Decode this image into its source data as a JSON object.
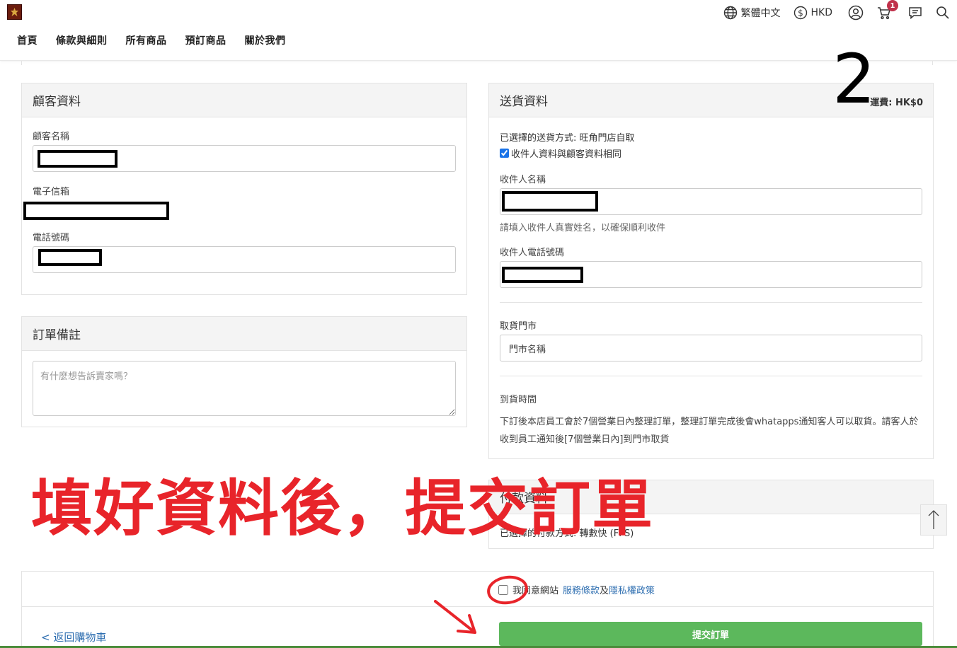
{
  "header": {
    "nav": [
      "首頁",
      "條款與細則",
      "所有商品",
      "預訂商品",
      "關於我們"
    ],
    "language": "繁體中文",
    "currency": "HKD",
    "cart_count": "1"
  },
  "customer": {
    "title": "顧客資料",
    "name_label": "顧客名稱",
    "email_label": "電子信箱",
    "phone_label": "電話號碼"
  },
  "note": {
    "title": "訂單備註",
    "placeholder": "有什麼想告訴賣家嗎？"
  },
  "delivery": {
    "title": "送貨資料",
    "fee": "運費: HK$0",
    "method": "已選擇的送貨方式: 旺角門店自取",
    "same_as_customer": "收件人資料與顧客資料相同",
    "recipient_name_label": "收件人名稱",
    "recipient_hint": "請填入收件人真實姓名，以確保順利收件",
    "recipient_phone_label": "收件人電話號碼",
    "pickup_store_label": "取貨門市",
    "pickup_store_value": "門市名稱",
    "arrival_label": "到貨時間",
    "arrival_text": "下訂後本店員工會於7個營業日內整理訂單，整理訂單完成後會whatapps通知客人可以取貨。請客人於收到員工通知後[7個營業日內]到門市取貨"
  },
  "payment": {
    "title": "付款資料",
    "method": "已選擇的付款方式: 轉數快 (FPS)"
  },
  "footer": {
    "agree_prefix": "我同意網站",
    "terms_link": "服務條款",
    "and": "及",
    "privacy_link": "隱私權政策",
    "back_to_cart": "< 返回購物車",
    "submit": "提交訂單"
  },
  "overlay": {
    "step_number": "2",
    "instruction": "填好資料後，提交訂單"
  },
  "colors": {
    "submit_green": "#5cb85c",
    "annotation_red": "#e8242a",
    "link_blue": "#2f6fb1",
    "badge_red": "#c0304a"
  }
}
